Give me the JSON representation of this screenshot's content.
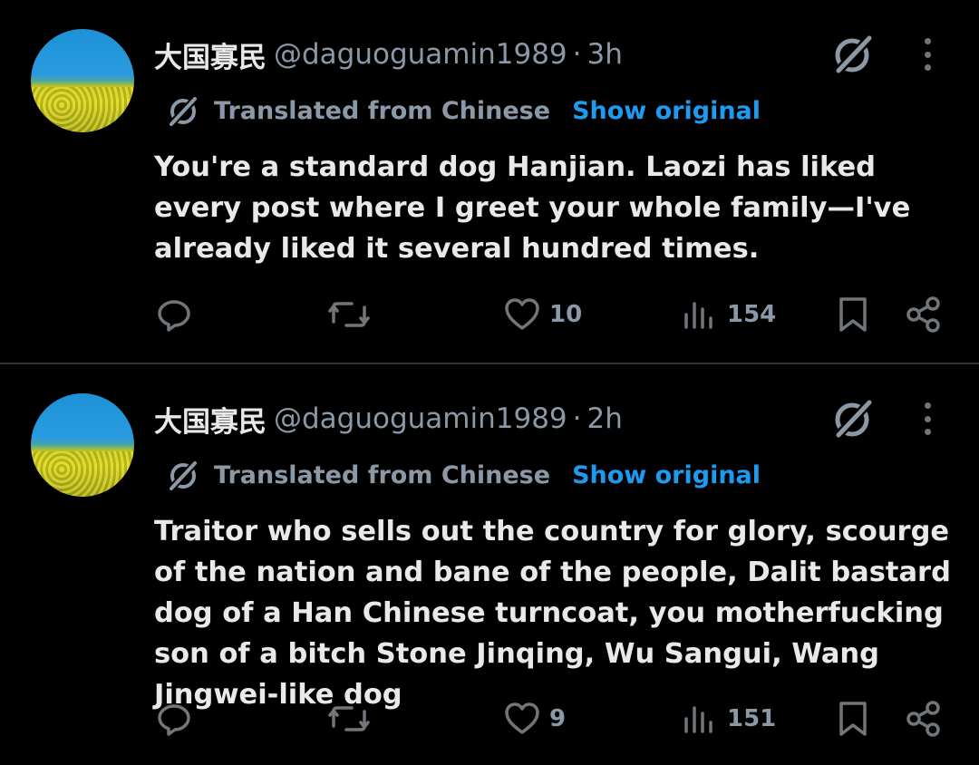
{
  "posts": [
    {
      "author": "大国寡民",
      "handle": "@daguoguamin1989",
      "separator": "·",
      "time": "3h",
      "translated_label": "Translated from Chinese",
      "show_original": "Show original",
      "text": "You're a standard dog Hanjian. Laozi has liked every post where I greet your whole family—I've already liked it several hundred times.",
      "likes": "10",
      "views": "154"
    },
    {
      "author": "大国寡民",
      "handle": "@daguoguamin1989",
      "separator": "·",
      "time": "2h",
      "translated_label": "Translated from Chinese",
      "show_original": "Show original",
      "text": "Traitor who sells out the country for glory, scourge of the nation and bane of the people, Dalit bastard dog of a Han Chinese turncoat, you motherfucking son of a bitch Stone Jinqing, Wu Sangui, Wang Jingwei-like dog",
      "likes": "9",
      "views": "151"
    }
  ],
  "icons": {
    "avatar": "landscape-avatar-icon",
    "grok": "grok-icon",
    "more": "more-vertical-icon",
    "reply": "reply-icon",
    "repost": "repost-icon",
    "like": "heart-icon",
    "views": "views-icon",
    "bookmark": "bookmark-icon",
    "share": "share-icon"
  },
  "colors": {
    "background": "#000000",
    "text": "#e7e9ea",
    "muted": "#71767b",
    "link": "#1d9bf0",
    "divider": "#2f3336"
  }
}
